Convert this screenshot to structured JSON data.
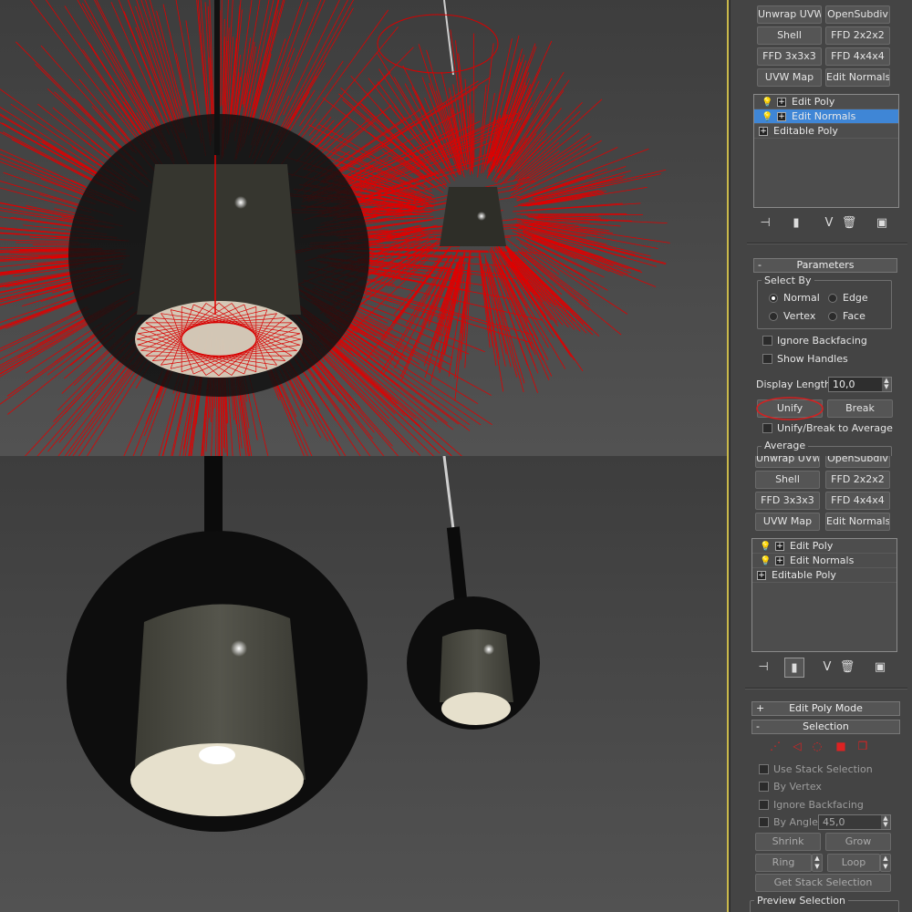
{
  "top": {
    "modifier_buttons": [
      [
        "Unwrap UVW",
        "OpenSubdiv"
      ],
      [
        "Shell",
        "FFD 2x2x2"
      ],
      [
        "FFD 3x3x3",
        "FFD 4x4x4"
      ],
      [
        "UVW Map",
        "Edit Normals"
      ]
    ],
    "stack": [
      {
        "label": "Edit Poly",
        "selected": false,
        "bulb": true
      },
      {
        "label": "Edit Normals",
        "selected": true,
        "bulb": true
      },
      {
        "label": "Editable Poly",
        "selected": false,
        "bulb": false
      }
    ],
    "parameters": {
      "rollout_title": "Parameters",
      "rollout_toggle": "-",
      "select_by_label": "Select By",
      "radio_normal": "Normal",
      "radio_edge": "Edge",
      "radio_vertex": "Vertex",
      "radio_face": "Face",
      "selected_radio": "Normal",
      "ignore_backfacing": "Ignore Backfacing",
      "show_handles": "Show Handles",
      "display_length_label": "Display Length:",
      "display_length_value": "10,0",
      "unify_button": "Unify",
      "break_button": "Break",
      "unify_break_avg": "Unify/Break to Average",
      "average_label": "Average"
    },
    "annotation_color": "#d42020",
    "normals_color": "#e00000"
  },
  "bottom": {
    "modifier_buttons": [
      [
        "Unwrap UVW",
        "OpenSubdiv"
      ],
      [
        "Shell",
        "FFD 2x2x2"
      ],
      [
        "FFD 3x3x3",
        "FFD 4x4x4"
      ],
      [
        "UVW Map",
        "Edit Normals"
      ]
    ],
    "stack": [
      {
        "label": "Edit Poly",
        "selected": false,
        "bulb": true
      },
      {
        "label": "Edit Normals",
        "selected": false,
        "bulb": true
      },
      {
        "label": "Editable Poly",
        "selected": false,
        "bulb": false
      }
    ],
    "edit_poly_mode": {
      "title": "Edit Poly Mode",
      "toggle": "+"
    },
    "selection": {
      "title": "Selection",
      "toggle": "-",
      "use_stack_selection": "Use Stack Selection",
      "by_vertex": "By Vertex",
      "ignore_backfacing": "Ignore Backfacing",
      "by_angle": "By Angle:",
      "by_angle_value": "45,0",
      "shrink": "Shrink",
      "grow": "Grow",
      "ring": "Ring",
      "loop": "Loop",
      "get_stack_selection": "Get Stack Selection",
      "preview_selection": "Preview Selection"
    }
  },
  "icons": {
    "pin": "pin-stack-icon",
    "show_end": "show-end-result-icon",
    "unique": "make-unique-icon",
    "remove": "remove-modifier-icon",
    "configure": "configure-modifier-sets-icon",
    "bulb": "light-bulb-icon",
    "expand": "expand-plus-icon"
  }
}
